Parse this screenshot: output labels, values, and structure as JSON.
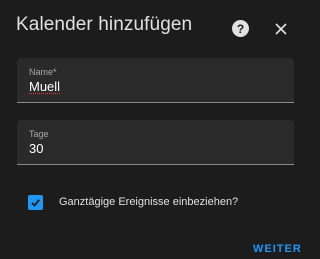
{
  "dialog": {
    "title": "Kalender hinzufügen",
    "help_icon": "help-circle-icon",
    "help_glyph": "?",
    "close_icon": "close-icon"
  },
  "form": {
    "name": {
      "label": "Name*",
      "value": "Muell"
    },
    "days": {
      "label": "Tage",
      "value": "30"
    },
    "all_day": {
      "label": "Ganztägige Ereignisse einbeziehen?",
      "checked": true,
      "icon": "check-icon"
    }
  },
  "actions": {
    "next_label": "WEITER"
  },
  "colors": {
    "background": "#1c1c1c",
    "field_background": "#2a2a2a",
    "accent": "#2196f3",
    "text": "#e1e1e1"
  }
}
